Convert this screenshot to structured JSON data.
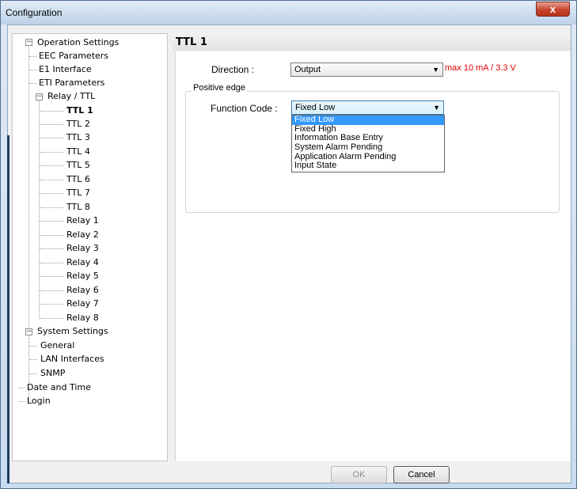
{
  "window": {
    "title": "Configuration",
    "close_glyph": "x"
  },
  "tree": {
    "operation_settings": "Operation Settings",
    "eec_parameters": "EEC Parameters",
    "e1_interface": "E1 Interface",
    "eti_parameters": "ETI Parameters",
    "relay_ttl": "Relay / TTL",
    "ttl": [
      "TTL 1",
      "TTL 2",
      "TTL 3",
      "TTL 4",
      "TTL 5",
      "TTL 6",
      "TTL 7",
      "TTL 8"
    ],
    "relay": [
      "Relay 1",
      "Relay 2",
      "Relay 3",
      "Relay 4",
      "Relay 5",
      "Relay 6",
      "Relay 7",
      "Relay 8"
    ],
    "system_settings": "System Settings",
    "general": "General",
    "lan_interfaces": "LAN Interfaces",
    "snmp": "SNMP",
    "date_time": "Date and Time",
    "login": "Login",
    "expander_minus": "−"
  },
  "panel": {
    "title": "TTL 1",
    "direction_label": "Direction :",
    "direction_value": "Output",
    "direction_hint": "max 10 mA / 3.3 V",
    "group_label": "Positive edge",
    "function_label": "Function Code :",
    "function_value": "Fixed Low",
    "dropdown_arrow": "▼",
    "function_options": [
      "Fixed Low",
      "Fixed High",
      "Information Base Entry",
      "System Alarm Pending",
      "Application Alarm Pending",
      "Input State"
    ]
  },
  "buttons": {
    "ok": "OK",
    "cancel": "Cancel"
  },
  "colors": {
    "hint": "#e00000",
    "selection": "#3399ff"
  }
}
